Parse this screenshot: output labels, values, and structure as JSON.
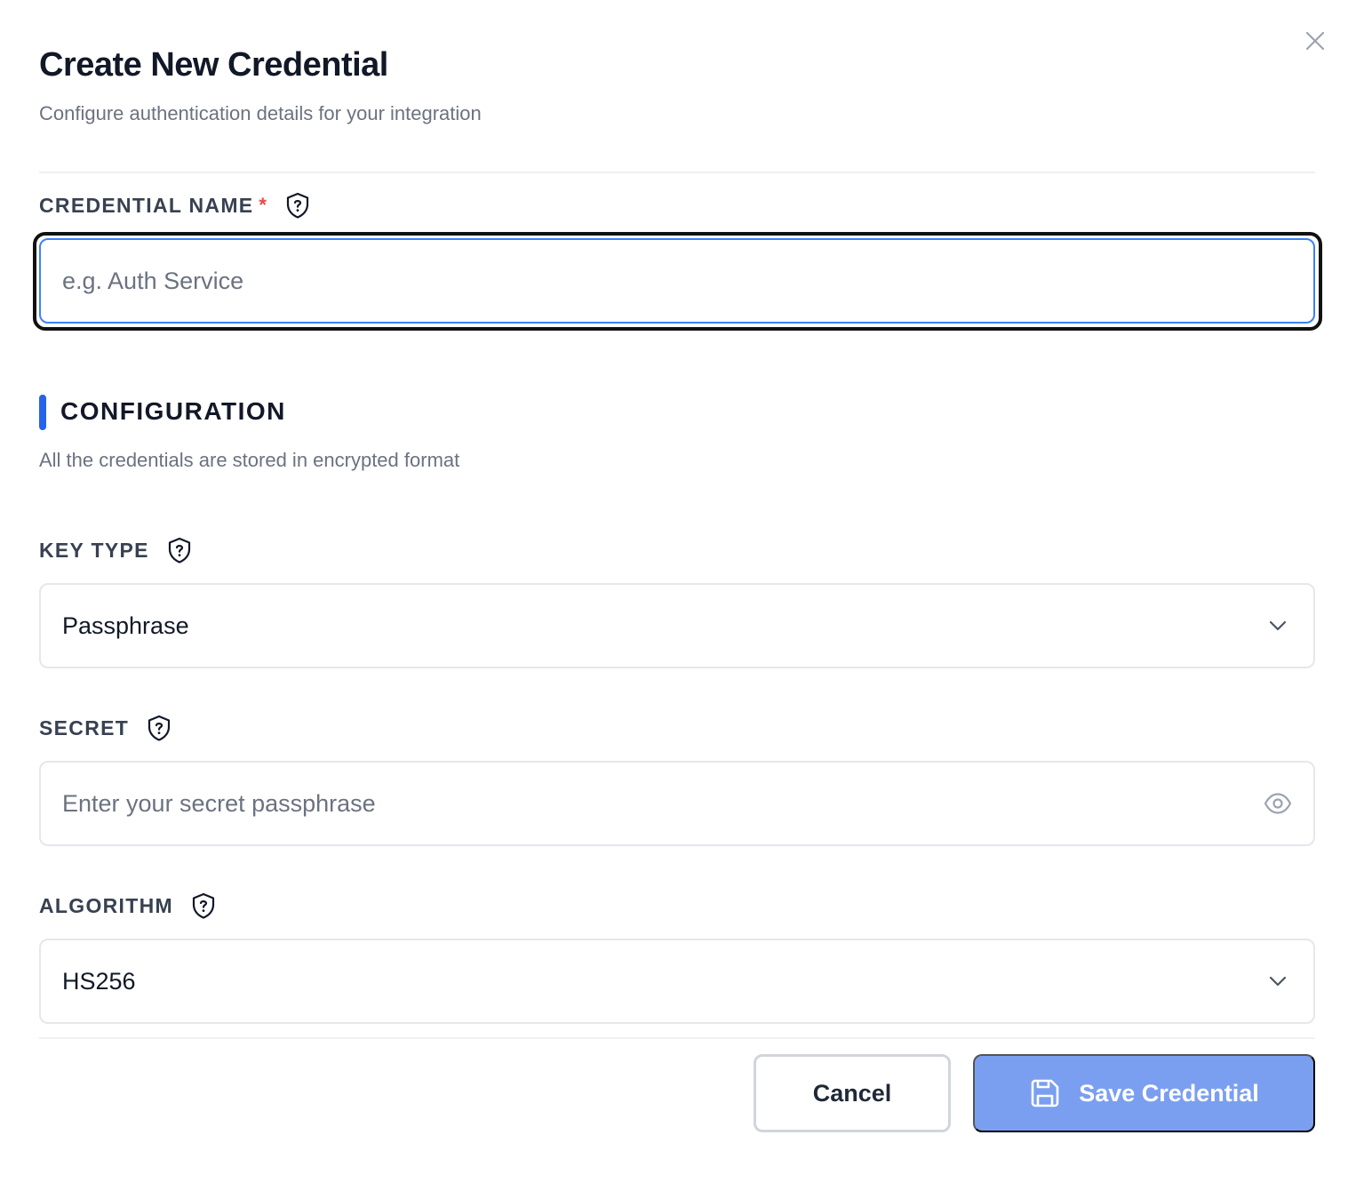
{
  "dialog": {
    "title": "Create New Credential",
    "subtitle": "Configure authentication details for your integration"
  },
  "credential_name": {
    "label": "CREDENTIAL NAME",
    "required_marker": "*",
    "placeholder": "e.g. Auth Service",
    "value": ""
  },
  "configuration": {
    "title": "CONFIGURATION",
    "description": "All the credentials are stored in encrypted format"
  },
  "key_type": {
    "label": "KEY TYPE",
    "selected": "Passphrase"
  },
  "secret": {
    "label": "SECRET",
    "placeholder": "Enter your secret passphrase",
    "value": ""
  },
  "algorithm": {
    "label": "ALGORITHM",
    "selected": "HS256"
  },
  "footer": {
    "cancel_label": "Cancel",
    "save_label": "Save Credential"
  },
  "colors": {
    "accent": "#2563eb",
    "required": "#ef4444",
    "save_button_bg": "#7b9ff0",
    "focus_border": "#3b82f6"
  },
  "icons": {
    "close": "close-icon",
    "help": "shield-question-icon",
    "dropdown": "chevron-down-icon",
    "reveal": "eye-icon",
    "save": "save-icon"
  }
}
